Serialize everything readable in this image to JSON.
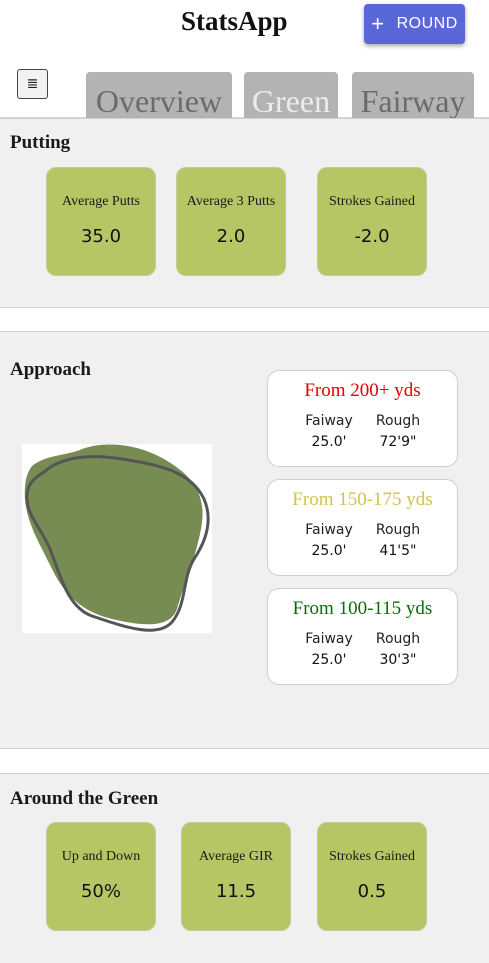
{
  "app": {
    "title": "StatsApp"
  },
  "header": {
    "round_button_label": "ROUND",
    "round_button_icon": "plus-icon",
    "menu_icon": "hamburger-menu-icon",
    "tabs": [
      {
        "label": "Overview",
        "active": false
      },
      {
        "label": "Green",
        "active": true
      },
      {
        "label": "Fairway",
        "active": false
      }
    ]
  },
  "putting": {
    "title": "Putting",
    "stats": [
      {
        "label": "Average Putts",
        "value": "35.0"
      },
      {
        "label": "Average 3 Putts",
        "value": "2.0"
      },
      {
        "label": "Strokes Gained",
        "value": "-2.0"
      }
    ]
  },
  "approach": {
    "title": "Approach",
    "ranges": [
      {
        "label": "From 200+ yds",
        "color": "#e00000",
        "fairway_label": "Faiway",
        "fairway_value": "25.0'",
        "rough_label": "Rough",
        "rough_value": "72'9\""
      },
      {
        "label": "From 150-175 yds",
        "color": "#d4c24a",
        "fairway_label": "Faiway",
        "fairway_value": "25.0'",
        "rough_label": "Rough",
        "rough_value": "41'5\""
      },
      {
        "label": "From 100-115 yds",
        "color": "#0b6b0b",
        "fairway_label": "Faiway",
        "fairway_value": "25.0'",
        "rough_label": "Rough",
        "rough_value": "30'3\""
      }
    ]
  },
  "around_green": {
    "title": "Around the Green",
    "stats": [
      {
        "label": "Up and Down",
        "value": "50%"
      },
      {
        "label": "Average GIR",
        "value": "11.5"
      },
      {
        "label": "Strokes Gained",
        "value": "0.5"
      }
    ]
  },
  "colors": {
    "accent": "#5a67d8",
    "stat_card": "#b6c665",
    "green_fill": "#778c52"
  }
}
